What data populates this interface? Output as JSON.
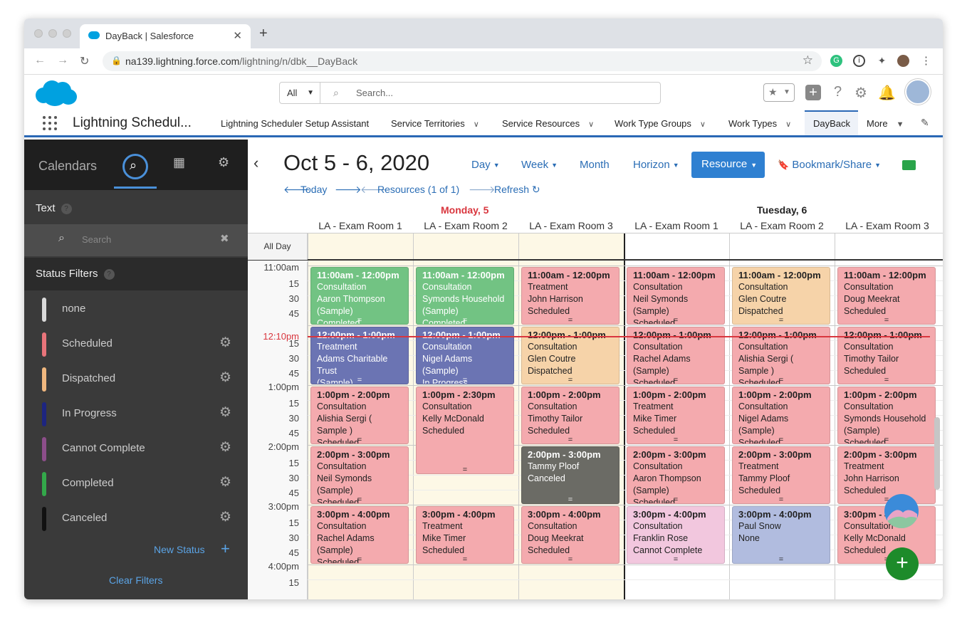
{
  "browser": {
    "tab_title": "DayBack | Salesforce",
    "url_host": "na139.lightning.force.com",
    "url_path": "/lightning/n/dbk__DayBack"
  },
  "sf_header": {
    "scope_label": "All",
    "search_placeholder": "Search..."
  },
  "navbar": {
    "app_name": "Lightning Schedul...",
    "items": [
      {
        "label": "Lightning Scheduler Setup Assistant",
        "chevron": false
      },
      {
        "label": "Service Territories",
        "chevron": true
      },
      {
        "label": "Service Resources",
        "chevron": true
      },
      {
        "label": "Work Type Groups",
        "chevron": true
      },
      {
        "label": "Work Types",
        "chevron": true
      },
      {
        "label": "DayBack",
        "chevron": false,
        "active": true
      },
      {
        "label": "More",
        "chevron": true
      }
    ]
  },
  "sidebar": {
    "title": "Calendars",
    "text_label": "Text",
    "search_placeholder": "Search",
    "status_filters_label": "Status Filters",
    "statuses": [
      {
        "name": "none",
        "color": "#d9d9d9",
        "gear": false
      },
      {
        "name": "Scheduled",
        "color": "#e8747a",
        "gear": true
      },
      {
        "name": "Dispatched",
        "color": "#f0b77e",
        "gear": true
      },
      {
        "name": "In Progress",
        "color": "#1d2580",
        "gear": true
      },
      {
        "name": "Cannot Complete",
        "color": "#8c4e8a",
        "gear": true
      },
      {
        "name": "Completed",
        "color": "#33a84a",
        "gear": true
      },
      {
        "name": "Canceled",
        "color": "#111111",
        "gear": true
      }
    ],
    "new_status_label": "New Status",
    "clear_filters_label": "Clear Filters"
  },
  "calendar": {
    "date_range": "Oct 5 - 6, 2020",
    "views": [
      "Day",
      "Week",
      "Month",
      "Horizon"
    ],
    "active_view": "Resource",
    "bookmark_label": "Bookmark/Share",
    "today_label": "Today",
    "resources_label": "Resources (1 of 1)",
    "refresh_label": "Refresh",
    "days": [
      {
        "label": "Monday, 5",
        "color": "#d9363e"
      },
      {
        "label": "Tuesday, 6",
        "color": "#222222"
      }
    ],
    "rooms": [
      "LA - Exam Room 1",
      "LA - Exam Room 2",
      "LA - Exam Room 3",
      "LA - Exam Room 1",
      "LA - Exam Room 2",
      "LA - Exam Room 3"
    ],
    "all_day_label": "All Day",
    "time_labels": [
      "11:00am",
      "15",
      "30",
      "45",
      "",
      "15",
      "30",
      "45",
      "1:00pm",
      "15",
      "30",
      "45",
      "2:00pm",
      "15",
      "30",
      "45",
      "3:00pm",
      "15",
      "30",
      "45",
      "4:00pm",
      "15"
    ],
    "now_label": "12:10pm",
    "events": [
      {
        "col": 0,
        "start": 0,
        "dur": 4,
        "time": "11:00am - 12:00pm",
        "lines": [
          "Consultation",
          "Aaron Thompson",
          "(Sample)",
          "Completed"
        ],
        "bg": "#72c383",
        "fg": "#ffffff"
      },
      {
        "col": 1,
        "start": 0,
        "dur": 4,
        "time": "11:00am - 12:00pm",
        "lines": [
          "Consultation",
          "Symonds Household",
          "(Sample)",
          "Completed"
        ],
        "bg": "#72c383",
        "fg": "#ffffff"
      },
      {
        "col": 2,
        "start": 0,
        "dur": 4,
        "time": "11:00am - 12:00pm",
        "lines": [
          "Treatment",
          "John Harrison",
          "Scheduled"
        ],
        "bg": "#f4aaae",
        "fg": "#222222"
      },
      {
        "col": 3,
        "start": 0,
        "dur": 4,
        "time": "11:00am - 12:00pm",
        "lines": [
          "Consultation",
          "Neil Symonds",
          "(Sample)",
          "Scheduled"
        ],
        "bg": "#f4aaae",
        "fg": "#222222"
      },
      {
        "col": 4,
        "start": 0,
        "dur": 4,
        "time": "11:00am - 12:00pm",
        "lines": [
          "Consultation",
          "Glen Coutre",
          "Dispatched"
        ],
        "bg": "#f6d3a9",
        "fg": "#222222"
      },
      {
        "col": 5,
        "start": 0,
        "dur": 4,
        "time": "11:00am - 12:00pm",
        "lines": [
          "Consultation",
          "Doug Meekrat",
          "Scheduled"
        ],
        "bg": "#f4aaae",
        "fg": "#222222"
      },
      {
        "col": 0,
        "start": 4,
        "dur": 4,
        "time": "12:00pm - 1:00pm",
        "lines": [
          "Treatment",
          "Adams Charitable Trust",
          "(Sample)",
          "In Progress"
        ],
        "bg": "#6b74b3",
        "fg": "#ffffff"
      },
      {
        "col": 1,
        "start": 4,
        "dur": 4,
        "time": "12:00pm - 1:00pm",
        "lines": [
          "Consultation",
          "Nigel Adams (Sample)",
          "In Progress"
        ],
        "bg": "#6b74b3",
        "fg": "#ffffff"
      },
      {
        "col": 2,
        "start": 4,
        "dur": 4,
        "time": "12:00pm - 1:00pm",
        "lines": [
          "Consultation",
          "Glen Coutre",
          "Dispatched"
        ],
        "bg": "#f6d3a9",
        "fg": "#222222"
      },
      {
        "col": 3,
        "start": 4,
        "dur": 4,
        "time": "12:00pm - 1:00pm",
        "lines": [
          "Consultation",
          "Rachel Adams",
          "(Sample)",
          "Scheduled"
        ],
        "bg": "#f4aaae",
        "fg": "#222222"
      },
      {
        "col": 4,
        "start": 4,
        "dur": 4,
        "time": "12:00pm - 1:00pm",
        "lines": [
          "Consultation",
          "Alishia Sergi ( Sample )",
          "Scheduled"
        ],
        "bg": "#f4aaae",
        "fg": "#222222"
      },
      {
        "col": 5,
        "start": 4,
        "dur": 4,
        "time": "12:00pm - 1:00pm",
        "lines": [
          "Consultation",
          "Timothy Tailor",
          "Scheduled"
        ],
        "bg": "#f4aaae",
        "fg": "#222222"
      },
      {
        "col": 0,
        "start": 8,
        "dur": 4,
        "time": "1:00pm - 2:00pm",
        "lines": [
          "Consultation",
          "Alishia Sergi ( Sample )",
          "Scheduled"
        ],
        "bg": "#f4aaae",
        "fg": "#222222"
      },
      {
        "col": 1,
        "start": 8,
        "dur": 6,
        "time": "1:00pm - 2:30pm",
        "lines": [
          "Consultation",
          "Kelly McDonald",
          "Scheduled"
        ],
        "bg": "#f4aaae",
        "fg": "#222222"
      },
      {
        "col": 2,
        "start": 8,
        "dur": 4,
        "time": "1:00pm - 2:00pm",
        "lines": [
          "Consultation",
          "Timothy Tailor",
          "Scheduled"
        ],
        "bg": "#f4aaae",
        "fg": "#222222"
      },
      {
        "col": 3,
        "start": 8,
        "dur": 4,
        "time": "1:00pm - 2:00pm",
        "lines": [
          "Treatment",
          "Mike Timer",
          "Scheduled"
        ],
        "bg": "#f4aaae",
        "fg": "#222222"
      },
      {
        "col": 4,
        "start": 8,
        "dur": 4,
        "time": "1:00pm - 2:00pm",
        "lines": [
          "Consultation",
          "Nigel Adams (Sample)",
          "Scheduled"
        ],
        "bg": "#f4aaae",
        "fg": "#222222"
      },
      {
        "col": 5,
        "start": 8,
        "dur": 4,
        "time": "1:00pm - 2:00pm",
        "lines": [
          "Consultation",
          "Symonds Household",
          "(Sample)",
          "Scheduled"
        ],
        "bg": "#f4aaae",
        "fg": "#222222"
      },
      {
        "col": 0,
        "start": 12,
        "dur": 4,
        "time": "2:00pm - 3:00pm",
        "lines": [
          "Consultation",
          "Neil Symonds",
          "(Sample)",
          "Scheduled"
        ],
        "bg": "#f4aaae",
        "fg": "#222222"
      },
      {
        "col": 2,
        "start": 12,
        "dur": 4,
        "time": "2:00pm - 3:00pm",
        "lines": [
          "Tammy Ploof",
          "Canceled"
        ],
        "bg": "#6b6b65",
        "fg": "#ffffff"
      },
      {
        "col": 3,
        "start": 12,
        "dur": 4,
        "time": "2:00pm - 3:00pm",
        "lines": [
          "Consultation",
          "Aaron Thompson",
          "(Sample)",
          "Scheduled"
        ],
        "bg": "#f4aaae",
        "fg": "#222222"
      },
      {
        "col": 4,
        "start": 12,
        "dur": 4,
        "time": "2:00pm - 3:00pm",
        "lines": [
          "Treatment",
          "Tammy Ploof",
          "Scheduled"
        ],
        "bg": "#f4aaae",
        "fg": "#222222"
      },
      {
        "col": 5,
        "start": 12,
        "dur": 4,
        "time": "2:00pm - 3:00pm",
        "lines": [
          "Treatment",
          "John Harrison",
          "Scheduled"
        ],
        "bg": "#f4aaae",
        "fg": "#222222"
      },
      {
        "col": 0,
        "start": 16,
        "dur": 4,
        "time": "3:00pm - 4:00pm",
        "lines": [
          "Consultation",
          "Rachel Adams",
          "(Sample)",
          "Scheduled"
        ],
        "bg": "#f4aaae",
        "fg": "#222222"
      },
      {
        "col": 1,
        "start": 16,
        "dur": 4,
        "time": "3:00pm - 4:00pm",
        "lines": [
          "Treatment",
          "Mike Timer",
          "Scheduled"
        ],
        "bg": "#f4aaae",
        "fg": "#222222"
      },
      {
        "col": 2,
        "start": 16,
        "dur": 4,
        "time": "3:00pm - 4:00pm",
        "lines": [
          "Consultation",
          "Doug Meekrat",
          "Scheduled"
        ],
        "bg": "#f4aaae",
        "fg": "#222222"
      },
      {
        "col": 3,
        "start": 16,
        "dur": 4,
        "time": "3:00pm - 4:00pm",
        "lines": [
          "Consultation",
          "Franklin Rose",
          "Cannot Complete"
        ],
        "bg": "#f2c7de",
        "fg": "#222222"
      },
      {
        "col": 4,
        "start": 16,
        "dur": 4,
        "time": "3:00pm - 4:00pm",
        "lines": [
          "Paul Snow",
          "None"
        ],
        "bg": "#b1bcdf",
        "fg": "#222222"
      },
      {
        "col": 5,
        "start": 16,
        "dur": 4,
        "time": "3:00pm - 4:00pm",
        "lines": [
          "Consultation",
          "Kelly McDonald",
          "Scheduled"
        ],
        "bg": "#f4aaae",
        "fg": "#222222"
      }
    ]
  }
}
